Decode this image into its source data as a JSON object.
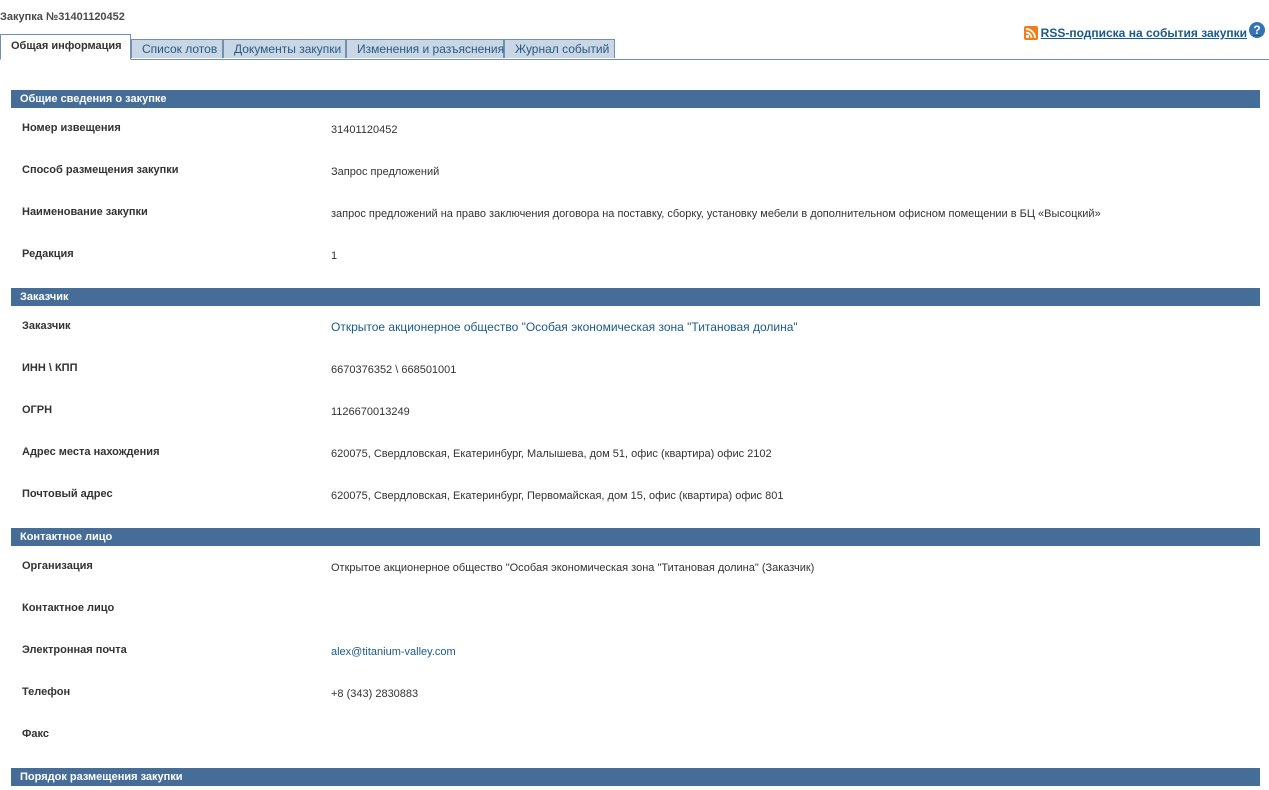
{
  "page": {
    "title": "Закупка №31401120452",
    "rss_link": "RSS-подписка на события закупки",
    "help_icon": "?"
  },
  "tabs": [
    {
      "label": "Общая информация",
      "active": true
    },
    {
      "label": "Список лотов",
      "active": false
    },
    {
      "label": "Документы закупки",
      "active": false
    },
    {
      "label": "Изменения и разъяснения",
      "active": false
    },
    {
      "label": "Журнал событий",
      "active": false
    }
  ],
  "sections": {
    "general": {
      "title": "Общие сведения о закупке",
      "notice_number_label": "Номер извещения",
      "notice_number": "31401120452",
      "method_label": "Способ размещения закупки",
      "method": "Запрос предложений",
      "name_label": "Наименование закупки",
      "name": "запрос предложений на право заключения договора на поставку, сборку, установку мебели в дополнительном офисном помещении в БЦ «Высоцкий»",
      "edition_label": "Редакция",
      "edition": "1"
    },
    "customer": {
      "title": "Заказчик",
      "customer_label": "Заказчик",
      "customer": "Открытое акционерное общество \"Особая экономическая зона \"Титановая долина\"",
      "inn_kpp_label": "ИНН \\ КПП",
      "inn_kpp": "6670376352 \\ 668501001",
      "ogrn_label": "ОГРН",
      "ogrn": "1126670013249",
      "address_label": "Адрес места нахождения",
      "address": "620075, Свердловская, Екатеринбург, Малышева, дом 51, офис (квартира) офис 2102",
      "postal_label": "Почтовый адрес",
      "postal": "620075, Свердловская, Екатеринбург, Первомайская, дом 15, офис (квартира) офис 801"
    },
    "contact": {
      "title": "Контактное лицо",
      "org_label": "Организация",
      "org": "Открытое акционерное общество \"Особая экономическая зона \"Титановая долина\" (Заказчик)",
      "person_label": "Контактное лицо",
      "person": "",
      "email_label": "Электронная почта",
      "email": "alex@titanium-valley.com",
      "phone_label": "Телефон",
      "phone": "+8 (343) 2830883",
      "fax_label": "Факс",
      "fax": ""
    },
    "procedure": {
      "title": "Порядок размещения закупки"
    }
  },
  "colors": {
    "section_header_bg": "#466d97",
    "tab_bg": "#c8d6e5",
    "link": "#1a5a8a",
    "rss_icon": "#f07d1a",
    "help_icon": "#3574b4"
  }
}
